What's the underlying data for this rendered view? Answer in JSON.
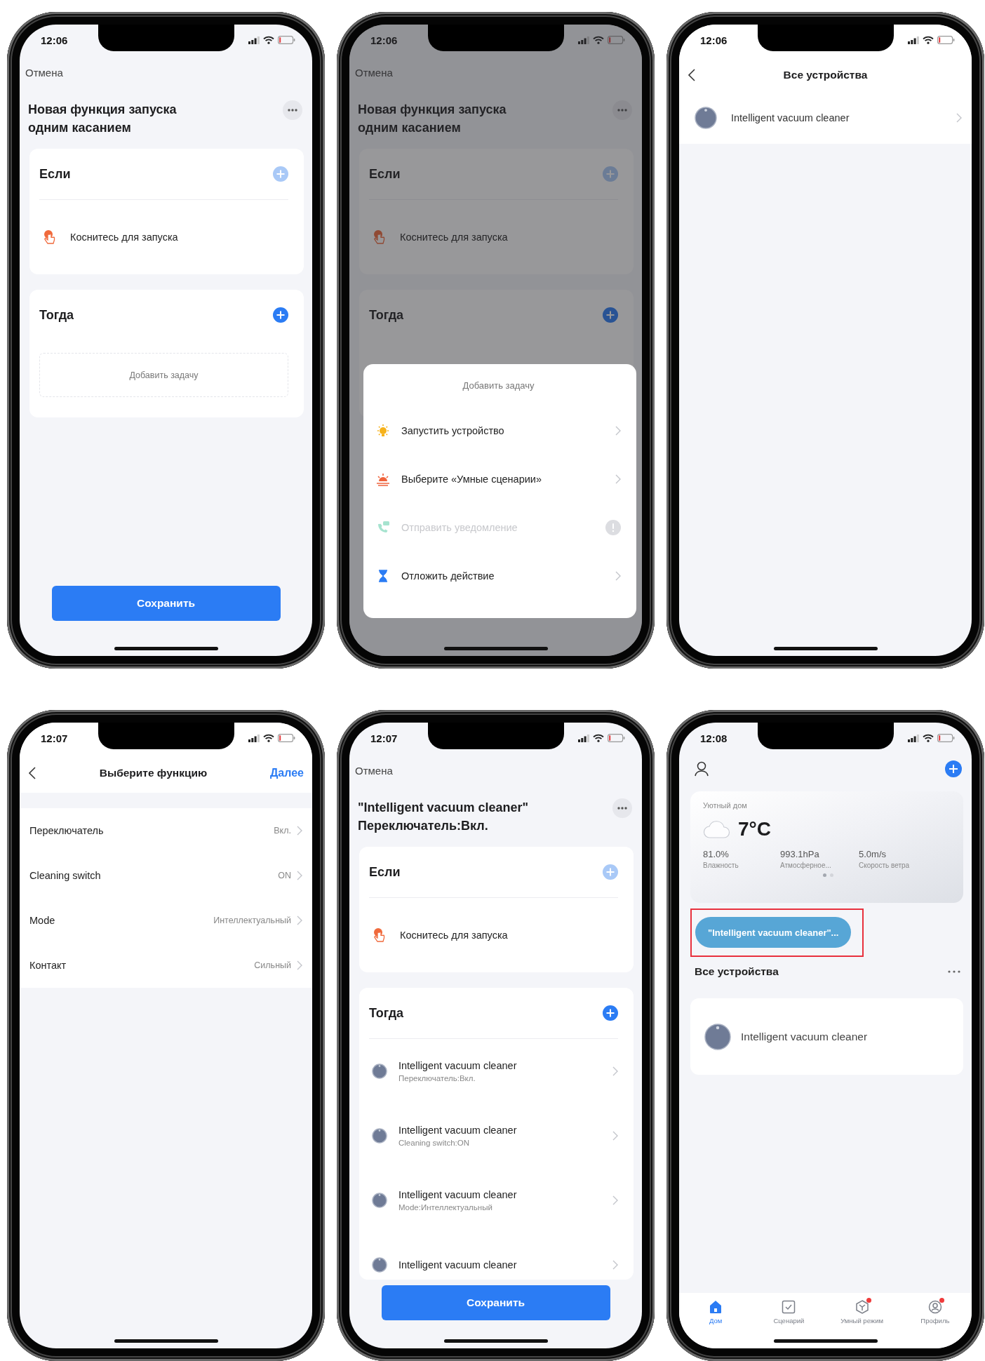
{
  "screens": [
    {
      "kind": "editor",
      "time": "12:06",
      "cancel": "Отмена",
      "title_lines": [
        "Новая функция запуска",
        "одним касанием"
      ],
      "if_card": {
        "heading": "Если",
        "add_disabled": true,
        "condition": "Коснитесь для запуска"
      },
      "then_card": {
        "heading": "Тогда",
        "add_disabled": false,
        "add_task": "Добавить задачу"
      },
      "save": "Сохранить"
    },
    {
      "kind": "editor",
      "time": "12:06",
      "cancel": "Отмена",
      "title_lines": [
        "Новая функция запуска",
        "одним касанием"
      ],
      "if_card": {
        "heading": "Если",
        "add_disabled": true,
        "condition": "Коснитесь для запуска"
      },
      "then_card": {
        "heading": "Тогда",
        "add_disabled": false
      },
      "dimmed": true,
      "sheet": {
        "title": "Добавить задачу",
        "options": [
          {
            "kind": "device",
            "label": "Запустить устройство",
            "disabled": false
          },
          {
            "kind": "scene",
            "label": "Выберите «Умные сценарии»",
            "disabled": false
          },
          {
            "kind": "notify",
            "label": "Отправить уведомление",
            "disabled": true
          },
          {
            "kind": "delay",
            "label": "Отложить действие",
            "disabled": false
          }
        ]
      }
    },
    {
      "kind": "device_list",
      "time": "12:06",
      "title": "Все устройства",
      "devices": [
        {
          "name": "Intelligent vacuum cleaner"
        }
      ]
    },
    {
      "kind": "function_picker",
      "time": "12:07",
      "title": "Выберите функцию",
      "next": "Далее",
      "functions": [
        {
          "label": "Переключатель",
          "value": "Вкл."
        },
        {
          "label": "Cleaning switch",
          "value": "ON"
        },
        {
          "label": "Mode",
          "value": "Интеллектуальный"
        },
        {
          "label": "Контакт",
          "value": "Сильный"
        }
      ]
    },
    {
      "kind": "editor",
      "time": "12:07",
      "cancel": "Отмена",
      "title_lines": [
        "\"Intelligent vacuum cleaner\"",
        "Переключатель:Вкл."
      ],
      "if_card": {
        "heading": "Если",
        "add_disabled": true,
        "condition": "Коснитесь для запуска"
      },
      "then_card": {
        "heading": "Тогда",
        "add_disabled": false,
        "tasks": [
          {
            "device": "Intelligent vacuum cleaner",
            "detail": "Переключатель:Вкл."
          },
          {
            "device": "Intelligent vacuum cleaner",
            "detail": "Cleaning switch:ON"
          },
          {
            "device": "Intelligent vacuum cleaner",
            "detail": "Mode:Интеллектуальный"
          },
          {
            "device": "Intelligent vacuum cleaner"
          }
        ]
      },
      "save": "Сохранить"
    },
    {
      "kind": "home",
      "time": "12:08",
      "weather": {
        "home_name": "Уютный дом",
        "temperature": "7°C",
        "stats": [
          {
            "value": "81.0%",
            "label": "Влажность"
          },
          {
            "value": "993.1hPa",
            "label": "Атмосферное..."
          },
          {
            "value": "5.0m/s",
            "label": "Скорость ветра"
          }
        ],
        "page_dots": [
          {
            "selected": true
          },
          {
            "selected": false
          }
        ]
      },
      "scene_chip": {
        "label": "\"Intelligent vacuum cleaner\"...",
        "highlighted": true
      },
      "section_title": "Все устройства",
      "devices": [
        {
          "name": "Intelligent vacuum cleaner"
        }
      ],
      "tabs": [
        {
          "kind": "home",
          "label": "Дом",
          "selected": true,
          "badge": false
        },
        {
          "kind": "scenes",
          "label": "Сценарий",
          "selected": false,
          "badge": false
        },
        {
          "kind": "smart",
          "label": "Умный режим",
          "selected": false,
          "badge": true
        },
        {
          "kind": "profile",
          "label": "Профиль",
          "selected": false,
          "badge": true
        }
      ]
    }
  ]
}
